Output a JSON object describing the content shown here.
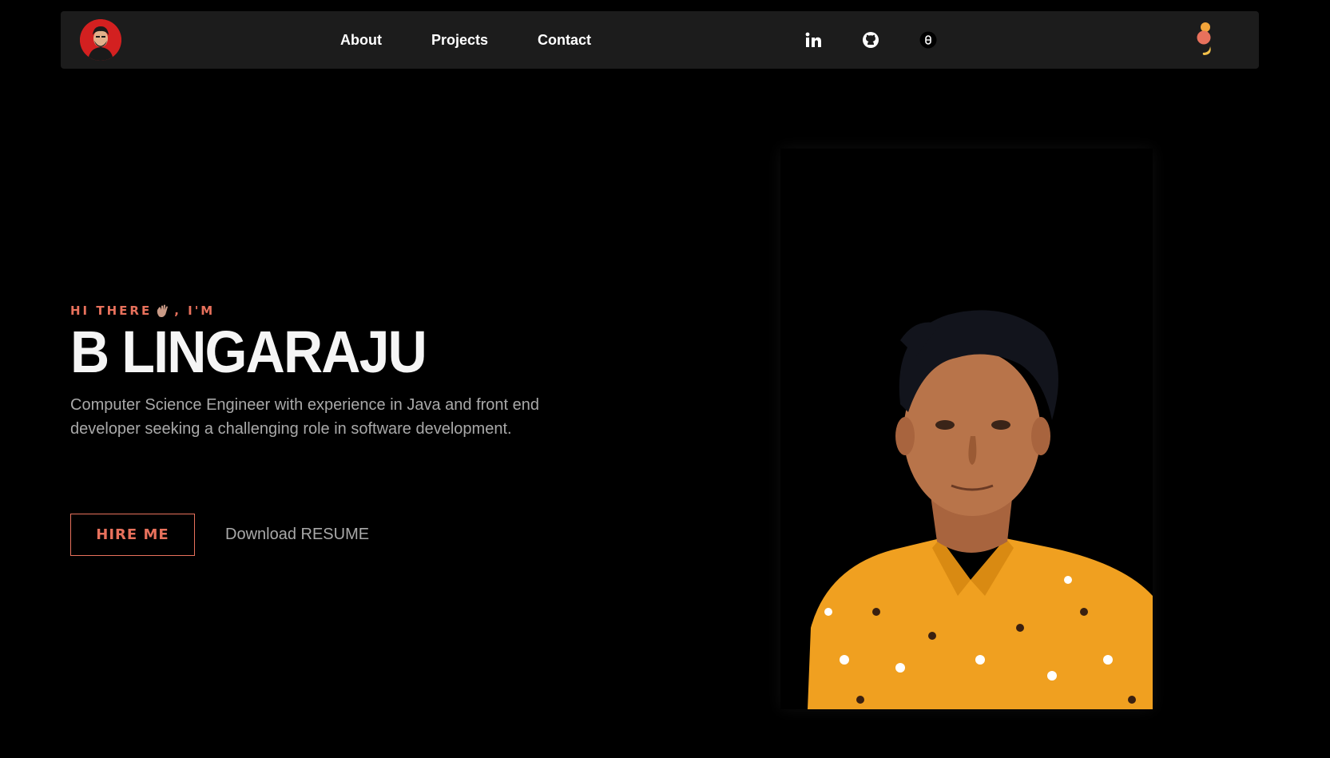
{
  "nav": {
    "logo_alt": "profile avatar",
    "links": [
      {
        "label": "About"
      },
      {
        "label": "Projects"
      },
      {
        "label": "Contact"
      }
    ],
    "social": [
      {
        "icon": "linkedin-icon"
      },
      {
        "icon": "github-icon"
      },
      {
        "icon": "hashnode-icon"
      }
    ],
    "theme_toggle_icon": "theme-toggle-icon"
  },
  "hero": {
    "greeting_prefix": "HI THERE",
    "greeting_suffix": ", I'M",
    "greeting_emoji_icon": "waving-hand-icon",
    "name": "B LINGARAJU",
    "description": "Computer Science Engineer with experience in Java and front end developer seeking a challenging role in software development.",
    "hire_label": "HIRE ME",
    "resume_label": "Download RESUME"
  },
  "colors": {
    "background": "#000000",
    "navbar": "#1c1c1c",
    "accent": "#e8715c",
    "muted_text": "#a9a9a9",
    "shirt": "#f0a020"
  }
}
